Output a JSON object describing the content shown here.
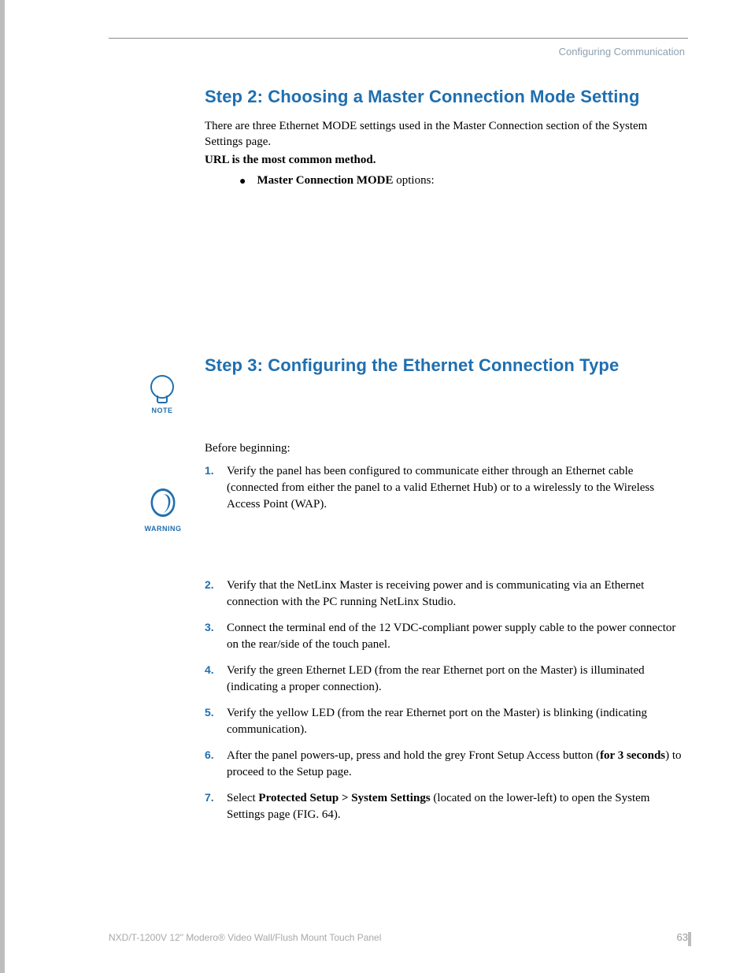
{
  "header": {
    "section_label": "Configuring Communication"
  },
  "step2": {
    "heading": "Step 2: Choosing a Master Connection Mode Setting",
    "intro_line1": "There are three Ethernet MODE settings used in the Master Connection section of the System Settings page.",
    "intro_line2_bold": "URL is the most common method.",
    "bullet_bold": "Master Connection MODE",
    "bullet_rest": " options:"
  },
  "step3": {
    "heading": "Step 3: Configuring the Ethernet Connection Type",
    "before": "Before beginning:",
    "items": {
      "i1": "Verify the panel has been configured to communicate either through an Ethernet cable (connected from either the panel to a valid Ethernet Hub) or to a wirelessly to the Wireless Access Point (WAP).",
      "i2": "Verify that the NetLinx Master is receiving power and is communicating via an Ethernet connection with the PC running NetLinx Studio.",
      "i3": "Connect the terminal end of the 12 VDC-compliant power supply cable to the power connector on the rear/side of the touch panel.",
      "i4": "Verify the green Ethernet LED (from the rear Ethernet port on the Master) is illuminated (indicating a proper connection).",
      "i5": "Verify the yellow LED (from the rear Ethernet port on the Master) is blinking (indicating communication).",
      "i6_a": "After the panel powers-up, press and hold the grey Front Setup Access button (",
      "i6_bold": "for 3 seconds",
      "i6_b": ") to proceed to the Setup page.",
      "i7_a": "Select ",
      "i7_bold": "Protected Setup > System Settings",
      "i7_b": " (located on the lower-left) to open the System Settings page (FIG. 64)."
    }
  },
  "icons": {
    "note_label": "NOTE",
    "warning_label": "WARNING"
  },
  "footer": {
    "product": "NXD/T-1200V 12\" Modero® Video Wall/Flush Mount Touch Panel",
    "page_number": "63"
  }
}
